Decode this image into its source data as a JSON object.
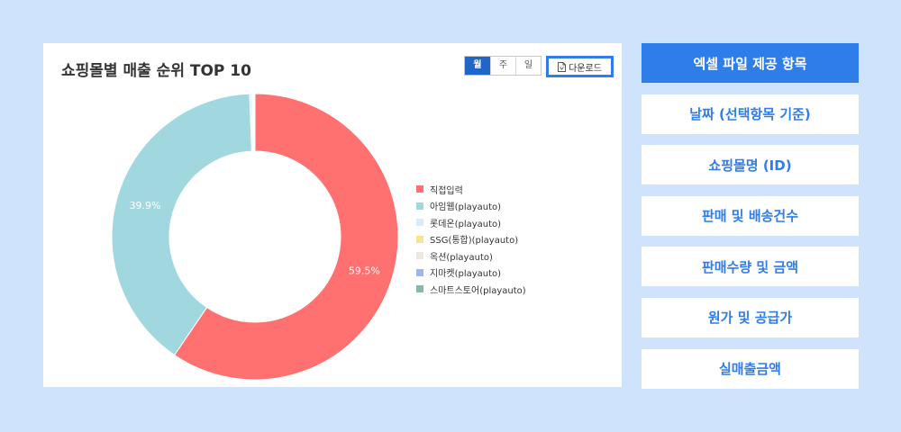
{
  "card": {
    "title": "쇼핑몰별 매출 순위 TOP 10"
  },
  "period": {
    "options": [
      {
        "label": "월",
        "active": true
      },
      {
        "label": "주",
        "active": false
      },
      {
        "label": "일",
        "active": false
      }
    ]
  },
  "download": {
    "label": "다운로드",
    "icon": "file-icon"
  },
  "chart_data": {
    "type": "pie",
    "variant": "donut",
    "title": "쇼핑몰별 매출 순위 TOP 10",
    "legend_position": "right",
    "series": [
      {
        "name": "직접입력",
        "value": 59.5,
        "label": "59.5%",
        "color": "#ff7171"
      },
      {
        "name": "아임웹(playauto)",
        "value": 39.9,
        "label": "39.9%",
        "color": "#a1d8e0"
      },
      {
        "name": "롯데온(playauto)",
        "value": 0.2,
        "label": "",
        "color": "#d6ecfb"
      },
      {
        "name": "SSG(통합)(playauto)",
        "value": 0.1,
        "label": "",
        "color": "#fbe395"
      },
      {
        "name": "옥션(playauto)",
        "value": 0.1,
        "label": "",
        "color": "#ece7e1"
      },
      {
        "name": "지마켓(playauto)",
        "value": 0.1,
        "label": "",
        "color": "#9db4ef"
      },
      {
        "name": "스마트스토어(playauto)",
        "value": 0.1,
        "label": "",
        "color": "#89b9a3"
      }
    ]
  },
  "side_menu": {
    "items": [
      {
        "label": "엑셀 파일 제공 항목",
        "primary": true
      },
      {
        "label": "날짜 (선택항목 기준)",
        "primary": false
      },
      {
        "label": "쇼핑몰명 (ID)",
        "primary": false
      },
      {
        "label": "판매 및 배송건수",
        "primary": false
      },
      {
        "label": "판매수량 및 금액",
        "primary": false
      },
      {
        "label": "원가 및 공급가",
        "primary": false
      },
      {
        "label": "실매출금액",
        "primary": false
      }
    ]
  },
  "colors": {
    "accent": "#2f7de8",
    "background": "#cfe3fd",
    "active_tab": "#1e66c8"
  }
}
